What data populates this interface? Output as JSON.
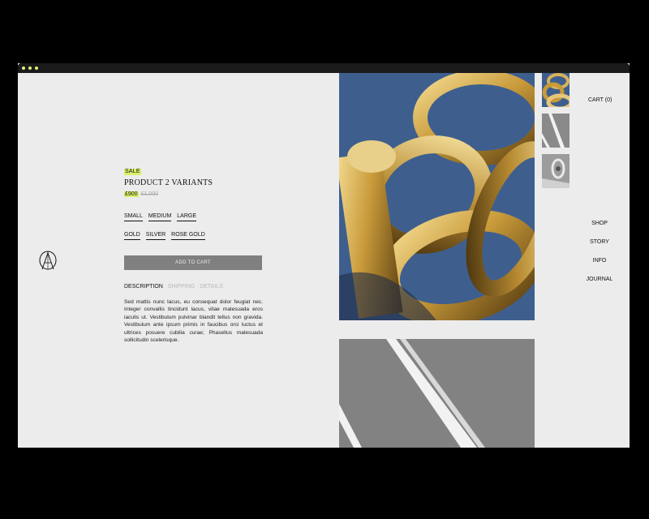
{
  "product": {
    "sale_label": "SALE",
    "title": "PRODUCT 2 VARIANTS",
    "price": "£900",
    "compare_price": "£1,000",
    "sizes": [
      "SMALL",
      "MEDIUM",
      "LARGE"
    ],
    "colors": [
      "GOLD",
      "SILVER",
      "ROSE GOLD"
    ],
    "add_to_cart": "ADD TO CART",
    "tabs": [
      "DESCRIPTION",
      "SHIPPING",
      "DETAILS"
    ],
    "active_tab": "DESCRIPTION",
    "description": "Sed mattis nunc lacus, eu consequat dolor feugiat nec. Integer convallis tincidunt lacus, vitae malesuada eros iaculis ut. Vestibulum pulvinar blandit tellus non gravida. Vestibulum ante ipsum primis in faucibus orci luctus et ultrices posuere cubilia curae; Phasellus malesuada sollicitudin scelerisque."
  },
  "header": {
    "cart": "CART (0)"
  },
  "nav": [
    "SHOP",
    "STORY",
    "INFO",
    "JOURNAL"
  ],
  "colors": {
    "accent": "#d8f06a",
    "background": "#ececec",
    "button": "#808080",
    "image_blue": "#3e5f8e",
    "gold": "#c9a24a"
  },
  "icons": {
    "logo": "monogram-logo-icon"
  }
}
